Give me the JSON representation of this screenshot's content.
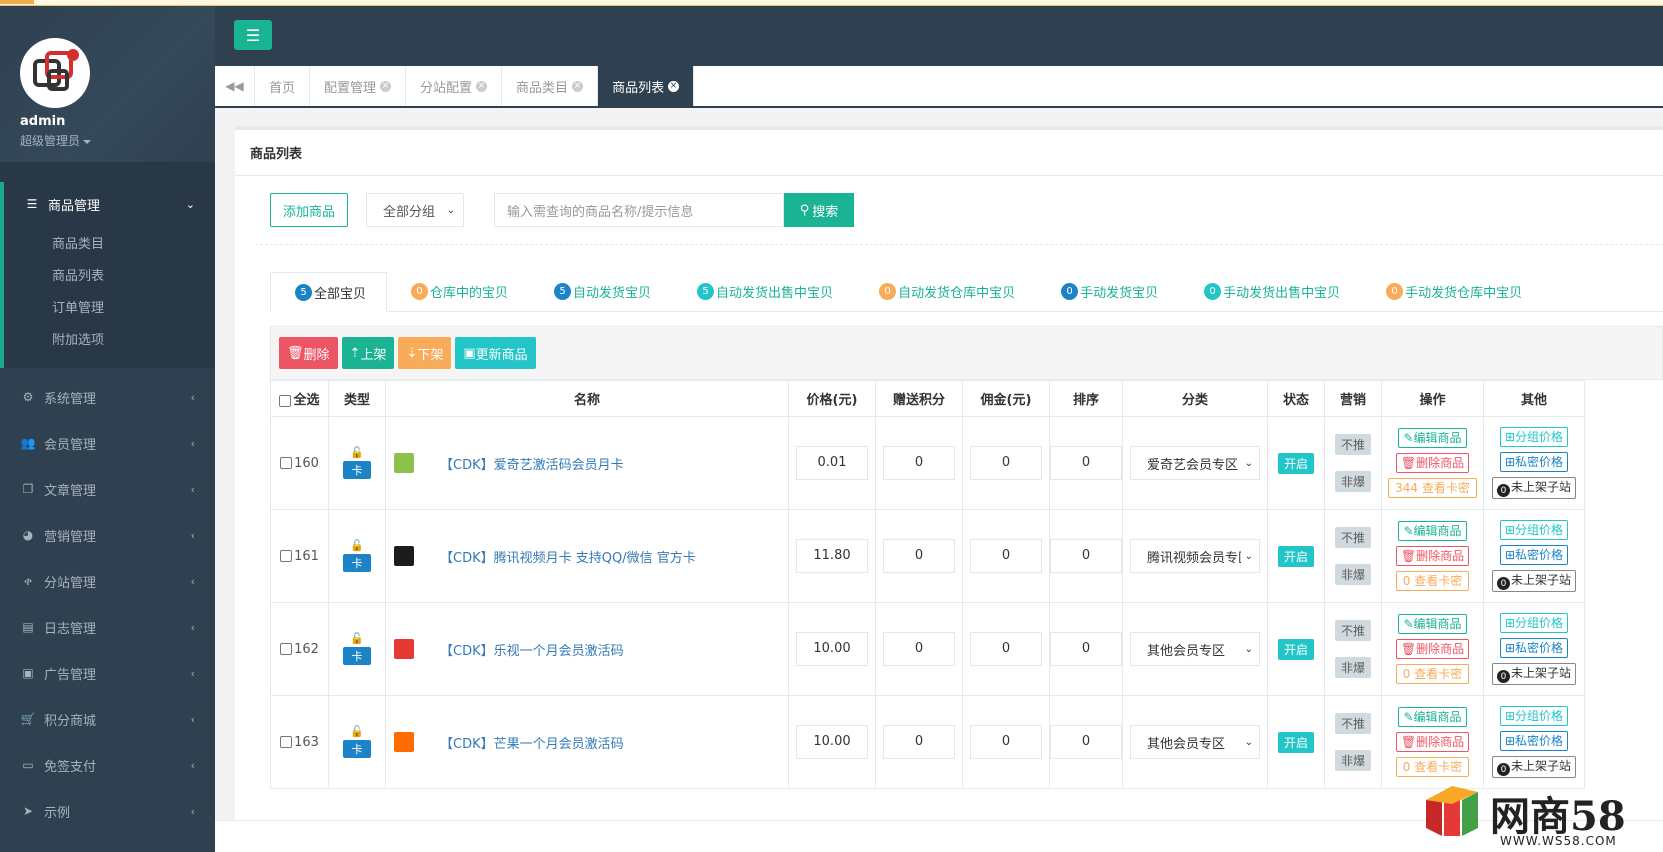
{
  "sidebar": {
    "user": "admin",
    "role": "超级管理员",
    "active_group": {
      "label": "商品管理",
      "items": [
        "商品类目",
        "商品列表",
        "订单管理",
        "附加选项"
      ]
    },
    "groups": [
      {
        "label": "系统管理",
        "icon": "gear-icon"
      },
      {
        "label": "会员管理",
        "icon": "users-icon"
      },
      {
        "label": "文章管理",
        "icon": "copy-icon"
      },
      {
        "label": "营销管理",
        "icon": "pie-chart-icon"
      },
      {
        "label": "分站管理",
        "icon": "tree-icon"
      },
      {
        "label": "日志管理",
        "icon": "list-icon"
      },
      {
        "label": "广告管理",
        "icon": "image-icon"
      },
      {
        "label": "积分商城",
        "icon": "cart-icon"
      },
      {
        "label": "免签支付",
        "icon": "credit-card-icon"
      },
      {
        "label": "示例",
        "icon": "paper-plane-icon"
      }
    ]
  },
  "tabs": [
    {
      "label": "首页",
      "closable": false
    },
    {
      "label": "配置管理",
      "closable": true
    },
    {
      "label": "分站配置",
      "closable": true
    },
    {
      "label": "商品类目",
      "closable": true
    },
    {
      "label": "商品列表",
      "closable": true,
      "active": true
    }
  ],
  "panel": {
    "title": "商品列表",
    "add_button": "添加商品",
    "group_select": "全部分组",
    "search_placeholder": "输入需查询的商品名称/提示信息",
    "search_button": "搜索"
  },
  "status_tabs": [
    {
      "count": "5",
      "label": "全部宝贝",
      "color": "blue",
      "active": true
    },
    {
      "count": "0",
      "label": "仓库中的宝贝",
      "color": "orange"
    },
    {
      "count": "5",
      "label": "自动发货宝贝",
      "color": "blue"
    },
    {
      "count": "5",
      "label": "自动发货出售中宝贝",
      "color": "teal"
    },
    {
      "count": "0",
      "label": "自动发货仓库中宝贝",
      "color": "orange"
    },
    {
      "count": "0",
      "label": "手动发货宝贝",
      "color": "blue"
    },
    {
      "count": "0",
      "label": "手动发货出售中宝贝",
      "color": "teal"
    },
    {
      "count": "0",
      "label": "手动发货仓库中宝贝",
      "color": "orange"
    }
  ],
  "actions": {
    "delete": "删除",
    "shelf_up": "上架",
    "shelf_down": "下架",
    "update": "更新商品"
  },
  "table": {
    "headers": {
      "select_all": "全选",
      "type": "类型",
      "name": "名称",
      "price": "价格(元)",
      "points": "赠送积分",
      "commission": "佣金(元)",
      "sort": "排序",
      "category": "分类",
      "status": "状态",
      "marketing": "营销",
      "ops": "操作",
      "other": "其他"
    },
    "type_label": "卡",
    "status_label": "开启",
    "marketing_labels": [
      "不推",
      "非爆"
    ],
    "op_labels": {
      "edit": "编辑商品",
      "delete": "删除商品",
      "view_keys": "查看卡密",
      "group_price": "分组价格",
      "private_price": "私密价格",
      "substation": "未上架子站"
    },
    "rows": [
      {
        "id": "160",
        "name": "【CDK】爱奇艺激活码会员月卡",
        "price": "0.01",
        "points": "0",
        "commission": "0",
        "sort": "0",
        "category": "爱奇艺会员专区",
        "keys": "344",
        "thumb_color": "#8bc34a"
      },
      {
        "id": "161",
        "name": "【CDK】腾讯视频月卡 支持QQ/微信 官方卡",
        "price": "11.80",
        "points": "0",
        "commission": "0",
        "sort": "0",
        "category": "腾讯视频会员专区",
        "keys": "0",
        "thumb_color": "#1b1b1b"
      },
      {
        "id": "162",
        "name": "【CDK】乐视一个月会员激活码",
        "price": "10.00",
        "points": "0",
        "commission": "0",
        "sort": "0",
        "category": "其他会员专区",
        "keys": "0",
        "thumb_color": "#e53935"
      },
      {
        "id": "163",
        "name": "【CDK】芒果一个月会员激活码",
        "price": "10.00",
        "points": "0",
        "commission": "0",
        "sort": "0",
        "category": "其他会员专区",
        "keys": "0",
        "thumb_color": "#ff6d00"
      }
    ]
  },
  "watermark": {
    "brand": "网商58",
    "url": "WWW.WS58.COM"
  }
}
